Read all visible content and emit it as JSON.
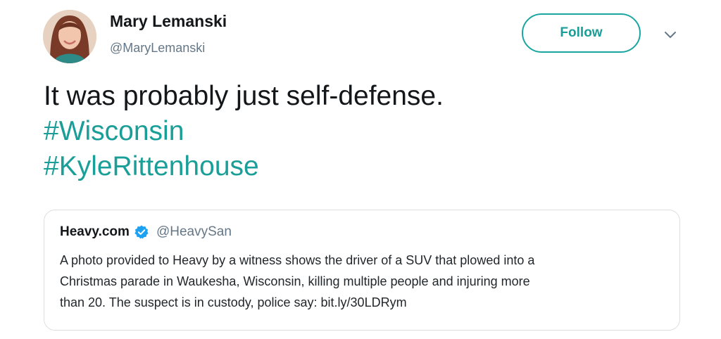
{
  "author": {
    "display_name": "Mary Lemanski",
    "handle": "@MaryLemanski",
    "avatar_icon": "profile-photo"
  },
  "actions": {
    "follow_label": "Follow",
    "menu_icon": "chevron-down-icon"
  },
  "tweet": {
    "lines": [
      "It was probably just self-defense.",
      "#Wisconsin",
      "#KyleRittenhouse"
    ],
    "hashtag_color": "#1a9e98"
  },
  "quoted_tweet": {
    "name": "Heavy.com",
    "verified_icon": "verified-badge-icon",
    "handle": "@HeavySan",
    "text_lines": [
      "A photo provided to Heavy by a witness shows the driver of a SUV that plowed into a",
      "Christmas parade in Waukesha, Wisconsin, killing multiple people and injuring more",
      "than 20. The suspect is in custody, police say: bit.ly/30LDRym"
    ]
  }
}
